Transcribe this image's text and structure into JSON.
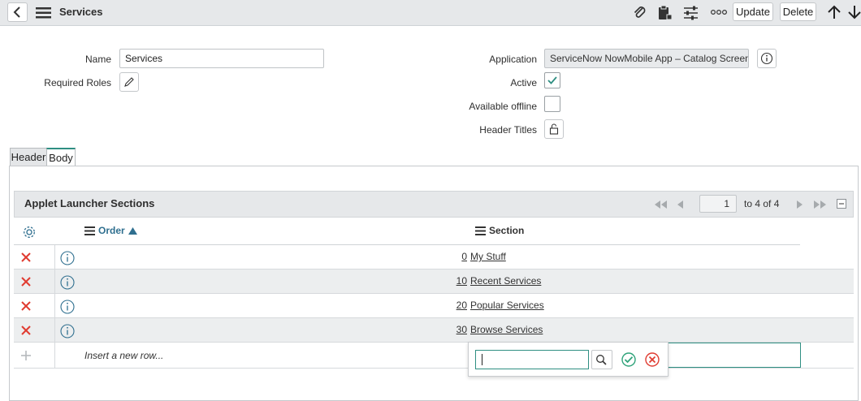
{
  "header": {
    "title": "Services",
    "update_label": "Update",
    "delete_label": "Delete"
  },
  "form": {
    "name_label": "Name",
    "name_value": "Services",
    "required_roles_label": "Required Roles",
    "application_label": "Application",
    "application_value": "ServiceNow NowMobile App – Catalog Screens a",
    "active_label": "Active",
    "active_checked": true,
    "available_offline_label": "Available offline",
    "available_offline_checked": false,
    "header_titles_label": "Header Titles"
  },
  "tabs": [
    {
      "label": "Header",
      "active": false
    },
    {
      "label": "Body",
      "active": true
    }
  ],
  "related_list": {
    "title": "Applet Launcher Sections",
    "page_input": "1",
    "range_text": "to 4 of 4",
    "columns": {
      "order": "Order",
      "section": "Section"
    },
    "rows": [
      {
        "order": "0",
        "section": "My Stuff"
      },
      {
        "order": "10",
        "section": "Recent Services"
      },
      {
        "order": "20",
        "section": "Popular Services"
      },
      {
        "order": "30",
        "section": "Browse Services"
      }
    ],
    "insert_row_text": "Insert a new row..."
  },
  "colors": {
    "accent": "#2f8f82",
    "delete_red": "#e03c31",
    "header_bg": "#e6e8ea"
  }
}
